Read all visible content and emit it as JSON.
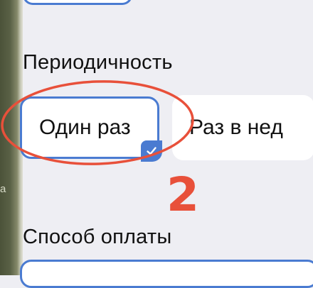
{
  "sidebar_partial_text": "a",
  "periodicity": {
    "label": "Периодичность",
    "options": [
      {
        "label": "Один раз",
        "selected": true
      },
      {
        "label": "Раз в нед",
        "selected": false
      }
    ]
  },
  "annotation": {
    "number": "2",
    "color": "#e8503a"
  },
  "payment": {
    "label": "Способ оплаты"
  },
  "colors": {
    "accent": "#4a7bd1",
    "background": "#eeeef3",
    "annotation": "#e8503a"
  }
}
